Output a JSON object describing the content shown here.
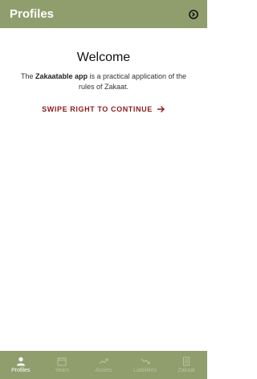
{
  "app_bar": {
    "title": "Profiles",
    "action_icon": "settings-icon"
  },
  "welcome": {
    "title": "Welcome",
    "text_prefix": "The ",
    "text_bold": "Zakaatable app",
    "text_suffix": " is a practical application of the rules of Zakaat.",
    "swipe_label": "SWIPE RIGHT TO CONTINUE",
    "swipe_icon": "arrow-right-icon"
  },
  "bottom_nav": {
    "items": [
      {
        "label": "Profiles",
        "icon": "person-icon",
        "active": true
      },
      {
        "label": "Years",
        "icon": "calendar-icon",
        "active": false
      },
      {
        "label": "Assets",
        "icon": "trending-up-icon",
        "active": false
      },
      {
        "label": "Liabilities",
        "icon": "trending-down-icon",
        "active": false
      },
      {
        "label": "Zakaat",
        "icon": "document-icon",
        "active": false
      }
    ]
  },
  "colors": {
    "primary": "#8f9e6c",
    "accent": "#8b1a1a",
    "nav_inactive": "#b9c3a1"
  }
}
